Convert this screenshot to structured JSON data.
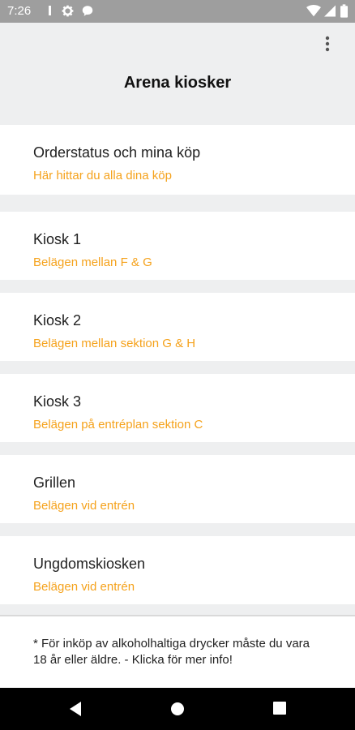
{
  "status_bar": {
    "time": "7:26",
    "icons": [
      "sd-card-icon",
      "settings-icon",
      "message-icon",
      "wifi-icon",
      "signal-icon",
      "battery-icon"
    ]
  },
  "app_bar": {
    "title": "Arena kiosker",
    "overflow_icon": "more-vert-icon"
  },
  "items": [
    {
      "title": "Orderstatus och mina köp",
      "subtitle": "Här hittar du alla dina köp"
    },
    {
      "title": "Kiosk 1",
      "subtitle": "Belägen mellan F & G"
    },
    {
      "title": "Kiosk 2",
      "subtitle": "Belägen mellan sektion G & H"
    },
    {
      "title": "Kiosk 3",
      "subtitle": "Belägen på entréplan sektion C"
    },
    {
      "title": "Grillen",
      "subtitle": "Belägen vid entrén"
    },
    {
      "title": "Ungdomskiosken",
      "subtitle": "Belägen vid entrén"
    }
  ],
  "footer": {
    "note": "* För inköp av alkoholhaltiga drycker måste du vara 18 år eller äldre. - Klicka för mer info!"
  },
  "nav_bar": {
    "icons": [
      "back-icon",
      "home-icon",
      "recents-icon"
    ]
  },
  "colors": {
    "accent": "#f5a21c",
    "background": "#eeeff0",
    "status_bar": "#9e9e9e",
    "nav_bar": "#000000"
  }
}
